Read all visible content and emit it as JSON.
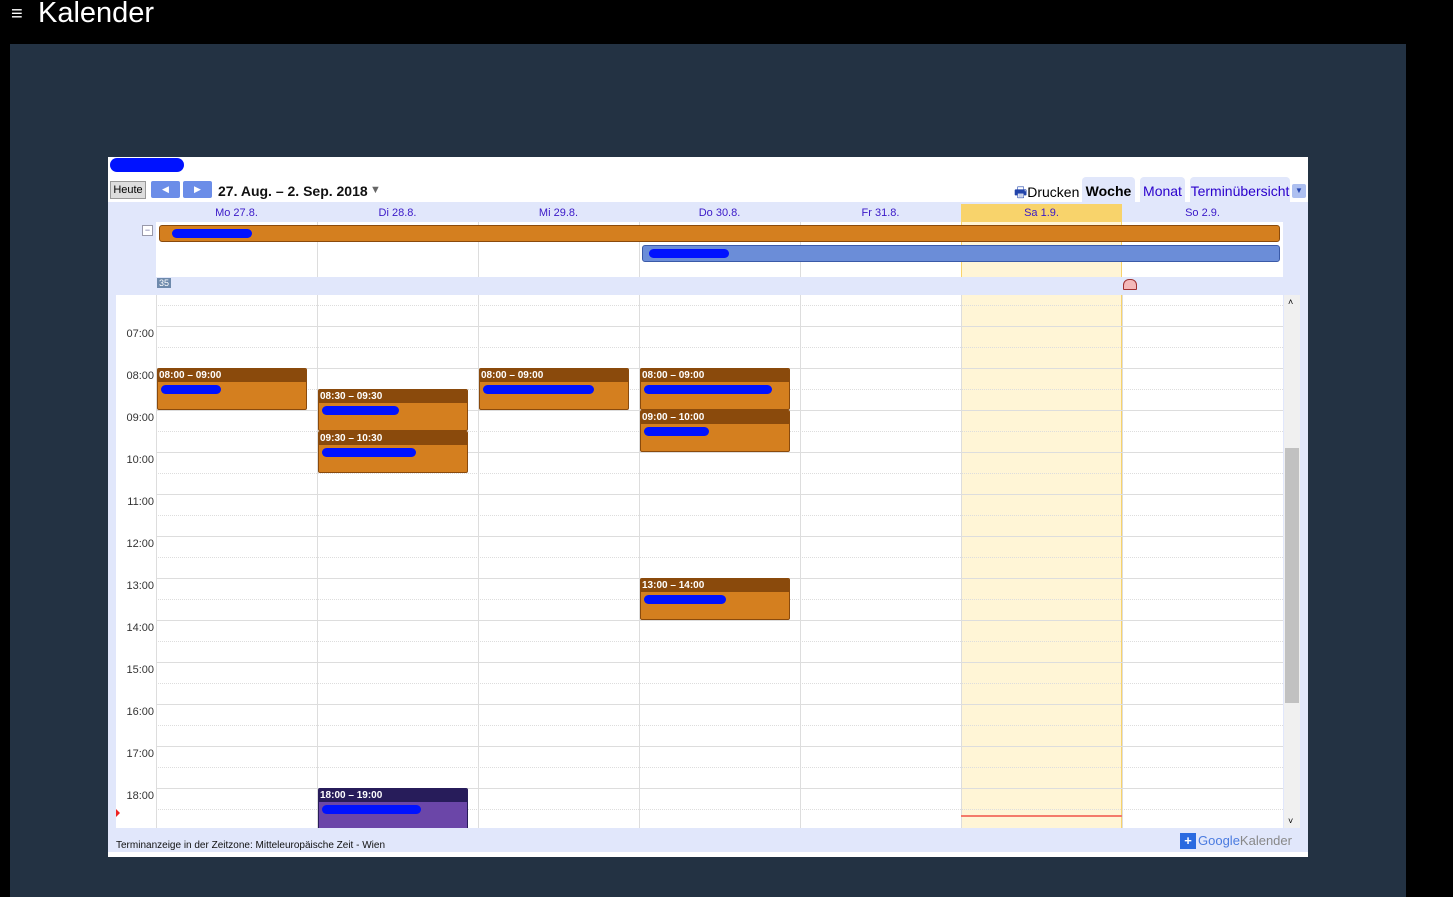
{
  "app": {
    "title": "Kalender",
    "menu_icon": "hamburger-icon"
  },
  "toolbar": {
    "today": "Heute",
    "range": "27. Aug. – 2. Sep. 2018",
    "print": "Drucken",
    "tabs": [
      "Woche",
      "Monat",
      "Terminübersicht"
    ]
  },
  "days": [
    "Mo 27.8.",
    "Di 28.8.",
    "Mi 29.8.",
    "Do 30.8.",
    "Fr 31.8.",
    "Sa 1.9.",
    "So 2.9."
  ],
  "week_number": "35",
  "hours": [
    "07:00",
    "08:00",
    "09:00",
    "10:00",
    "11:00",
    "12:00",
    "13:00",
    "14:00",
    "15:00",
    "16:00",
    "17:00",
    "18:00"
  ],
  "events": [
    {
      "day": 0,
      "start": 8,
      "end": 9,
      "time": "08:00 – 09:00",
      "color": "orange"
    },
    {
      "day": 1,
      "start": 8.5,
      "end": 9.5,
      "time": "08:30 – 09:30",
      "color": "orange"
    },
    {
      "day": 1,
      "start": 9.5,
      "end": 10.5,
      "time": "09:30 – 10:30",
      "color": "orange"
    },
    {
      "day": 2,
      "start": 8,
      "end": 9,
      "time": "08:00 – 09:00",
      "color": "orange"
    },
    {
      "day": 3,
      "start": 8,
      "end": 9,
      "time": "08:00 – 09:00",
      "color": "orange"
    },
    {
      "day": 3,
      "start": 9,
      "end": 10,
      "time": "09:00 – 10:00",
      "color": "orange"
    },
    {
      "day": 3,
      "start": 13,
      "end": 14,
      "time": "13:00 – 14:00",
      "color": "orange"
    },
    {
      "day": 1,
      "start": 18,
      "end": 19,
      "time": "18:00 – 19:00",
      "color": "purple"
    }
  ],
  "current_time_hour": 18.64,
  "footer": {
    "timezone": "Terminanzeige in der Zeitzone: Mitteleuropäische Zeit - Wien",
    "brand_google": "Google",
    "brand_cal": "Kalender"
  },
  "colors": {
    "orange": "#d47f1f",
    "blue": "#6b8dd8",
    "today": "#f8d36b"
  }
}
